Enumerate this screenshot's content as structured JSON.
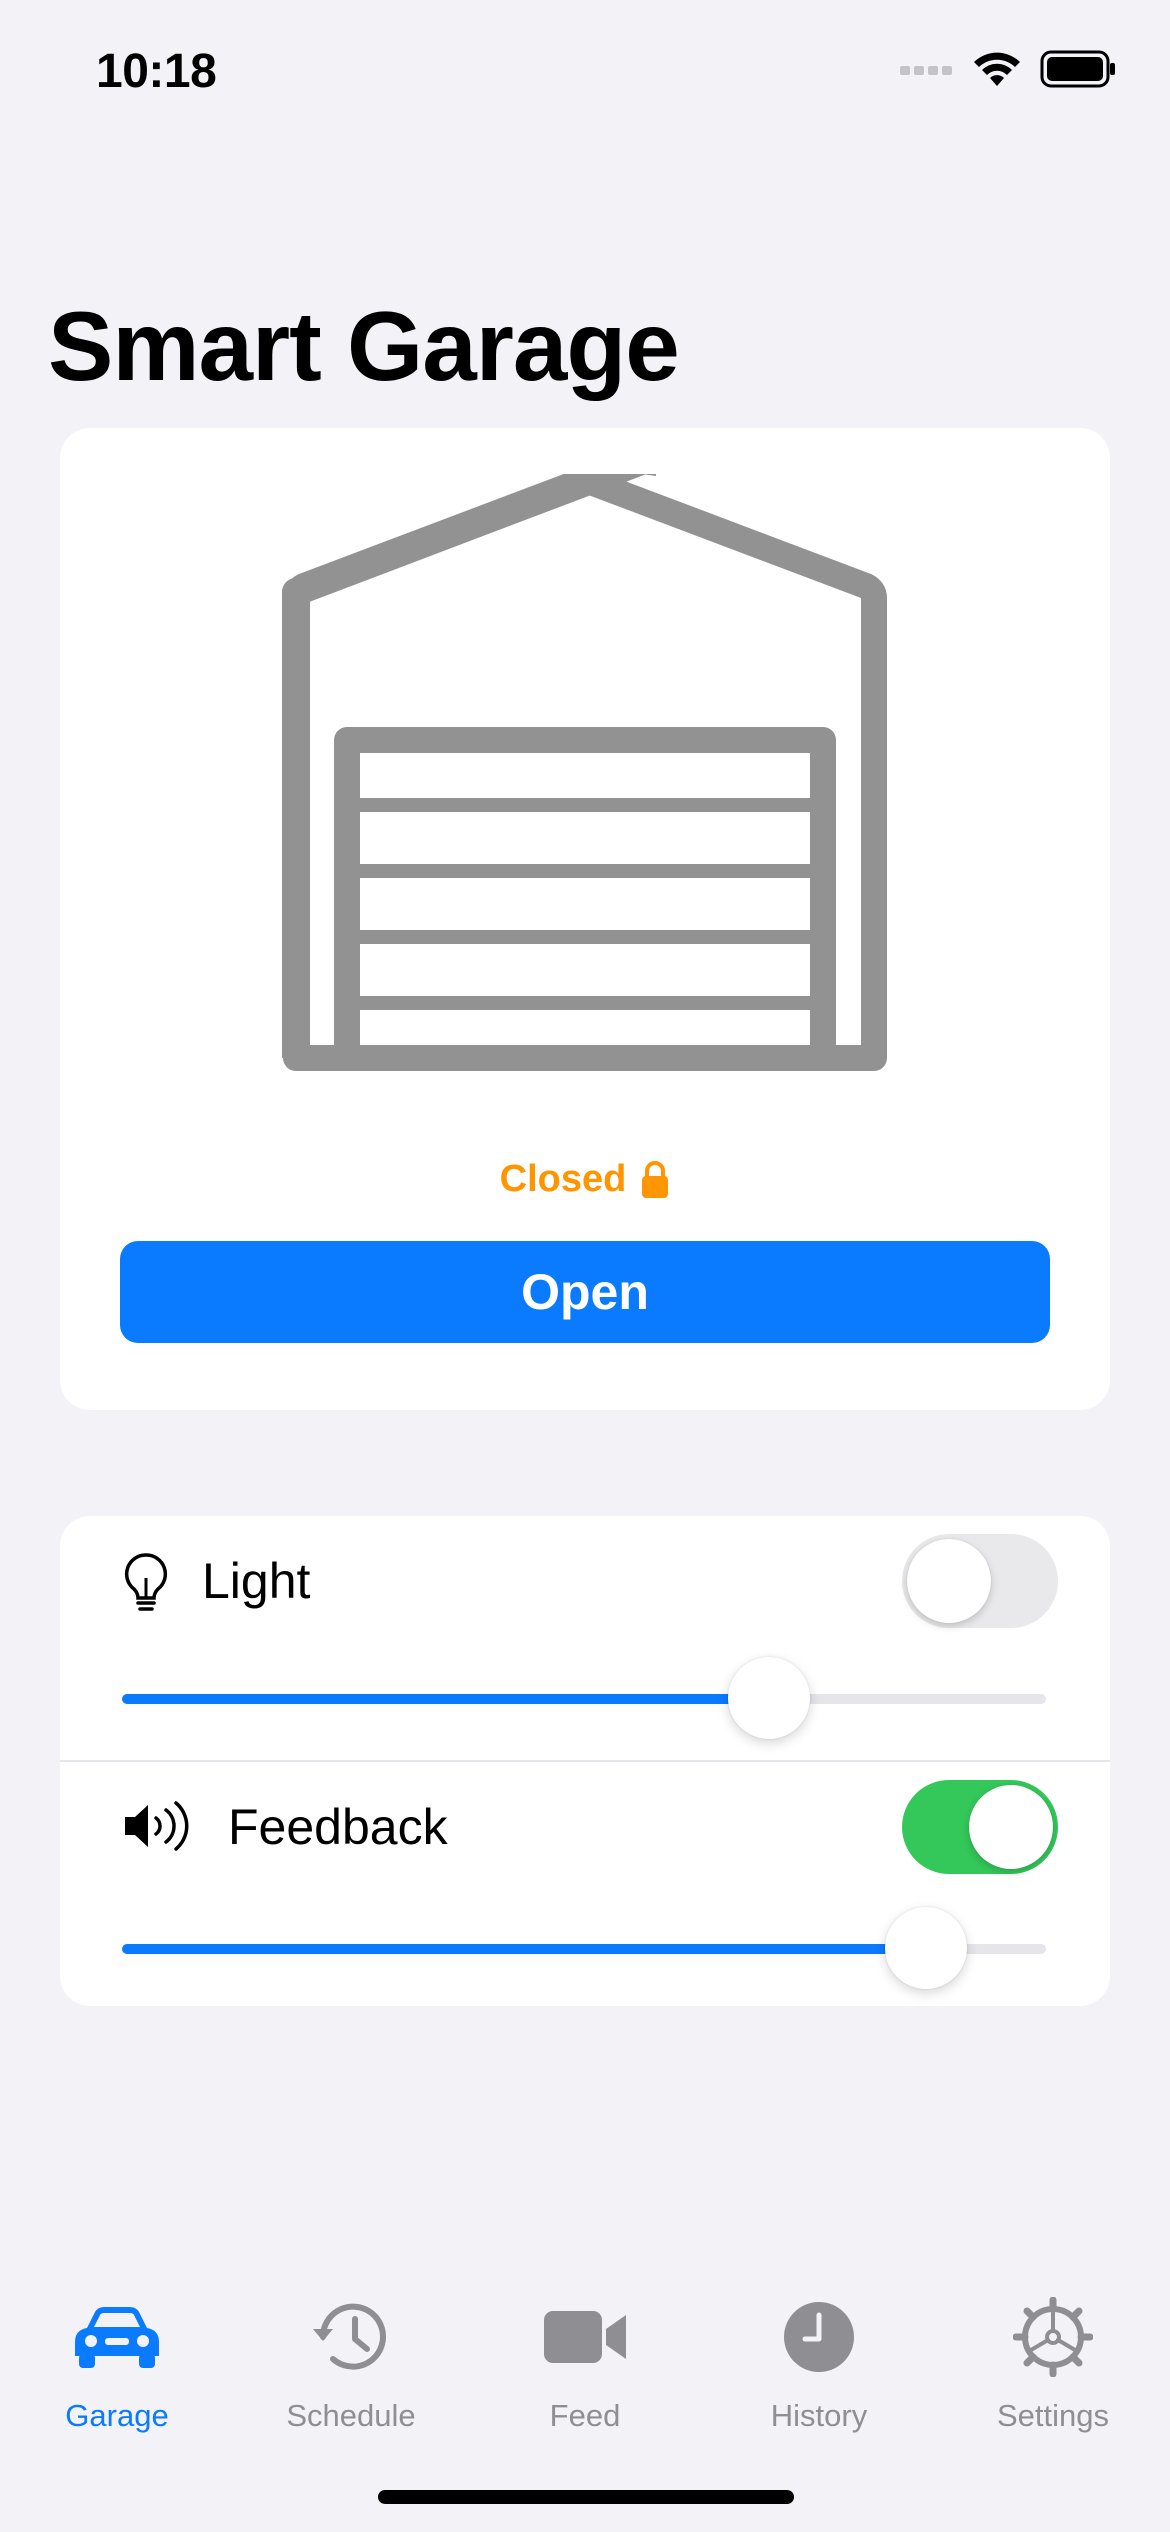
{
  "status_bar": {
    "time": "10:18"
  },
  "header": {
    "title": "Smart Garage"
  },
  "garage": {
    "status_text": "Closed",
    "status_icon": "lock-icon",
    "status_color": "#ff9500",
    "open_button_label": "Open",
    "accent": "#0a7aff"
  },
  "controls": {
    "light": {
      "label": "Light",
      "icon": "lightbulb-icon",
      "enabled": false,
      "level_percent": 70
    },
    "feedback": {
      "label": "Feedback",
      "icon": "speaker-icon",
      "enabled": true,
      "level_percent": 87,
      "toggle_color": "#34c759"
    }
  },
  "tab_bar": {
    "active": "Garage",
    "tabs": [
      {
        "label": "Garage",
        "icon": "car-icon"
      },
      {
        "label": "Schedule",
        "icon": "clock-arrow-icon"
      },
      {
        "label": "Feed",
        "icon": "video-camera-icon"
      },
      {
        "label": "History",
        "icon": "clock-icon"
      },
      {
        "label": "Settings",
        "icon": "gear-icon"
      }
    ]
  }
}
